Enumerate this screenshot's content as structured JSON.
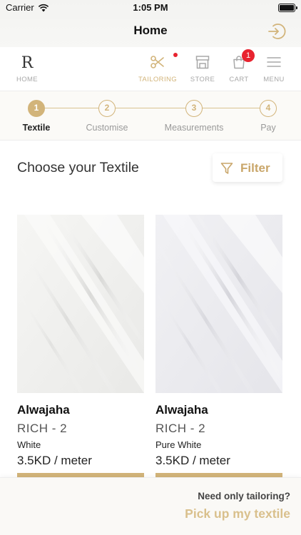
{
  "status_bar": {
    "carrier": "Carrier",
    "time": "1:05 PM"
  },
  "header": {
    "title": "Home",
    "logout_icon": "logout-icon"
  },
  "nav": {
    "logo_letter": "R",
    "items": [
      {
        "label": "HOME",
        "icon": "brand-logo",
        "active": false
      },
      {
        "label": "TAILORING",
        "icon": "scissors-icon",
        "active": true
      },
      {
        "label": "STORE",
        "icon": "store-icon",
        "active": false
      },
      {
        "label": "CART",
        "icon": "cart-bag-icon",
        "active": false,
        "badge": "1"
      },
      {
        "label": "MENU",
        "icon": "hamburger-icon",
        "active": false
      }
    ]
  },
  "stepper": {
    "steps": [
      {
        "number": "1",
        "label": "Textile",
        "active": true
      },
      {
        "number": "2",
        "label": "Customise",
        "active": false
      },
      {
        "number": "3",
        "label": "Measurements",
        "active": false
      },
      {
        "number": "4",
        "label": "Pay",
        "active": false
      }
    ]
  },
  "main": {
    "heading": "Choose your Textile",
    "filter_label": "Filter",
    "products": [
      {
        "name": "Alwajaha",
        "grade": "RICH - 2",
        "color": "White",
        "price": "3.5KD / meter"
      },
      {
        "name": "Alwajaha",
        "grade": "RICH - 2",
        "color": "Pure White",
        "price": "3.5KD / meter"
      }
    ]
  },
  "bottom_banner": {
    "question": "Need only tailoring?",
    "cta": "Pick up my textile"
  },
  "colors": {
    "accent": "#d2b47a",
    "badge": "#e8232f",
    "cta_text": "#d9c08c"
  }
}
